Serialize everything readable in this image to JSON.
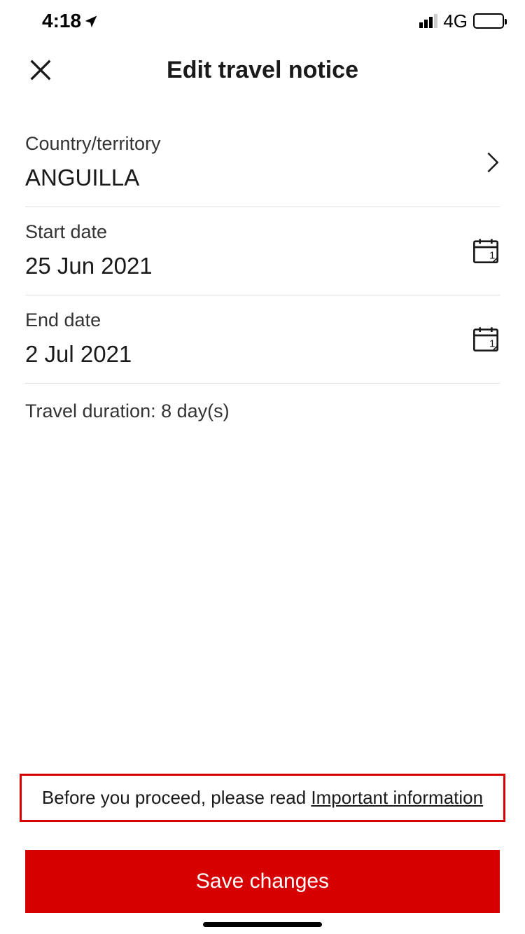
{
  "status": {
    "time": "4:18",
    "network": "4G"
  },
  "header": {
    "title": "Edit travel notice"
  },
  "fields": {
    "country": {
      "label": "Country/territory",
      "value": "ANGUILLA"
    },
    "start": {
      "label": "Start date",
      "value": "25 Jun 2021"
    },
    "end": {
      "label": "End date",
      "value": "2 Jul 2021"
    }
  },
  "duration": "Travel duration: 8 day(s)",
  "info": {
    "prefix": "Before you proceed, please read ",
    "link": "Important information"
  },
  "button": {
    "save": "Save changes"
  }
}
